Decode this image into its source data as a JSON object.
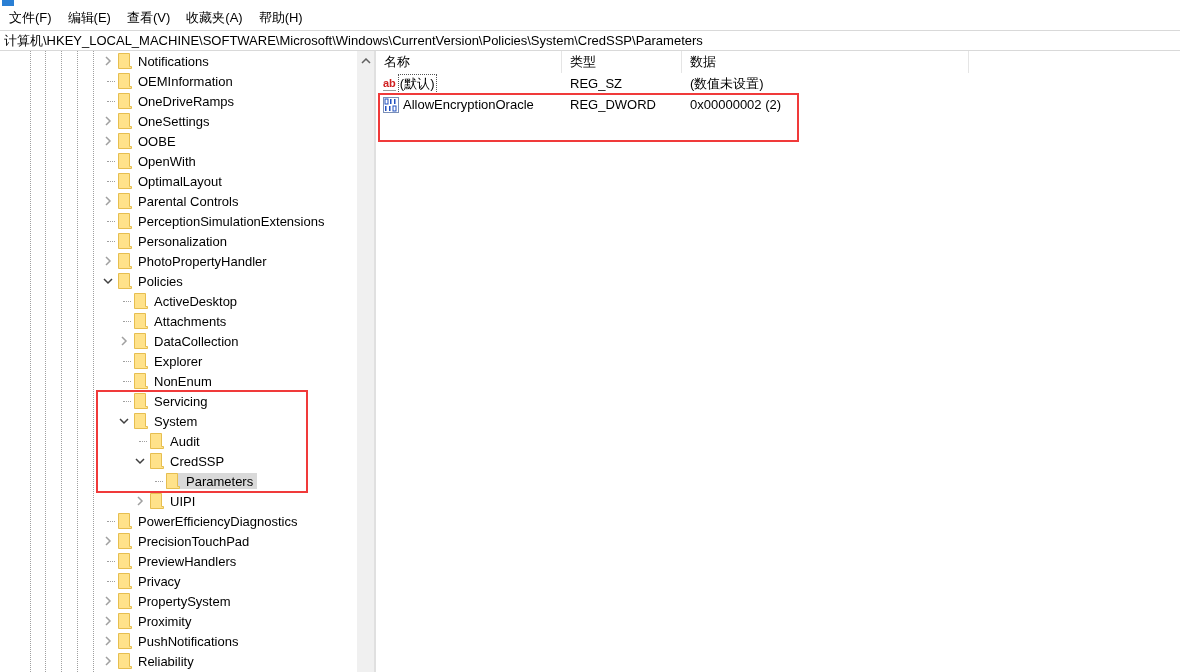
{
  "menu": [
    "文件(F)",
    "编辑(E)",
    "查看(V)",
    "收藏夹(A)",
    "帮助(H)"
  ],
  "address": "计算机\\HKEY_LOCAL_MACHINE\\SOFTWARE\\Microsoft\\Windows\\CurrentVersion\\Policies\\System\\CredSSP\\Parameters",
  "tree": [
    {
      "label": "Notifications",
      "kind": "branch",
      "expanded": false,
      "selected": false
    },
    {
      "label": "OEMInformation",
      "kind": "leaf",
      "selected": false
    },
    {
      "label": "OneDriveRamps",
      "kind": "leaf",
      "selected": false
    },
    {
      "label": "OneSettings",
      "kind": "branch",
      "expanded": false,
      "selected": false
    },
    {
      "label": "OOBE",
      "kind": "branch",
      "expanded": false,
      "selected": false
    },
    {
      "label": "OpenWith",
      "kind": "leaf",
      "selected": false
    },
    {
      "label": "OptimalLayout",
      "kind": "leaf",
      "selected": false
    },
    {
      "label": "Parental Controls",
      "kind": "branch",
      "expanded": false,
      "selected": false
    },
    {
      "label": "PerceptionSimulationExtensions",
      "kind": "leaf",
      "selected": false
    },
    {
      "label": "Personalization",
      "kind": "leaf",
      "selected": false
    },
    {
      "label": "PhotoPropertyHandler",
      "kind": "branch",
      "expanded": false,
      "selected": false
    },
    {
      "label": "Policies",
      "kind": "branch",
      "expanded": true,
      "selected": false,
      "children": [
        {
          "label": "ActiveDesktop",
          "kind": "leaf",
          "selected": false
        },
        {
          "label": "Attachments",
          "kind": "leaf",
          "selected": false
        },
        {
          "label": "DataCollection",
          "kind": "branch",
          "expanded": false,
          "selected": false
        },
        {
          "label": "Explorer",
          "kind": "leaf",
          "selected": false
        },
        {
          "label": "NonEnum",
          "kind": "leaf",
          "selected": false
        },
        {
          "label": "Servicing",
          "kind": "leaf",
          "selected": false
        },
        {
          "label": "System",
          "kind": "branch",
          "expanded": true,
          "selected": false,
          "children": [
            {
              "label": "Audit",
              "kind": "leaf",
              "selected": false
            },
            {
              "label": "CredSSP",
              "kind": "branch",
              "expanded": true,
              "selected": false,
              "children": [
                {
                  "label": "Parameters",
                  "kind": "leaf",
                  "selected": true
                }
              ]
            },
            {
              "label": "UIPI",
              "kind": "branch",
              "expanded": false,
              "selected": false
            }
          ]
        }
      ]
    },
    {
      "label": "PowerEfficiencyDiagnostics",
      "kind": "leaf",
      "selected": false
    },
    {
      "label": "PrecisionTouchPad",
      "kind": "branch",
      "expanded": false,
      "selected": false
    },
    {
      "label": "PreviewHandlers",
      "kind": "leaf",
      "selected": false
    },
    {
      "label": "Privacy",
      "kind": "leaf",
      "selected": false
    },
    {
      "label": "PropertySystem",
      "kind": "branch",
      "expanded": false,
      "selected": false
    },
    {
      "label": "Proximity",
      "kind": "branch",
      "expanded": false,
      "selected": false
    },
    {
      "label": "PushNotifications",
      "kind": "branch",
      "expanded": false,
      "selected": false
    },
    {
      "label": "Reliability",
      "kind": "branch",
      "expanded": false,
      "selected": false
    }
  ],
  "columns": [
    "名称",
    "类型",
    "数据"
  ],
  "values": [
    {
      "kind": "sz",
      "icon_text": "ab",
      "name": "(默认)",
      "type": "REG_SZ",
      "data": "(数值未设置)",
      "focused": true
    },
    {
      "kind": "dword",
      "name": "AllowEncryptionOracle",
      "type": "REG_DWORD",
      "data": "0x00000002 (2)",
      "focused": false
    }
  ]
}
